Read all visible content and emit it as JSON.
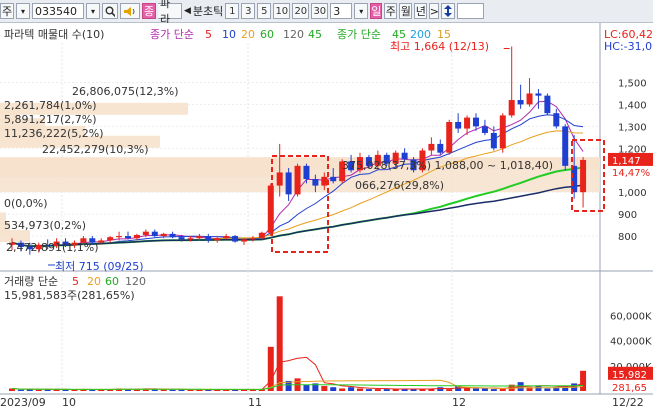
{
  "toolbar": {
    "market": "주",
    "code": "033540",
    "search_icon": "magnifier-icon",
    "sound_icon": "speaker-icon",
    "kind_badge": "종",
    "name_short": "파라",
    "prev_arrow": "◀",
    "interval_label": "분초틱",
    "intervals": [
      "1",
      "3",
      "5",
      "10",
      "20",
      "30"
    ],
    "interval_select": "3",
    "period_day": "일",
    "periods": [
      "주",
      "월",
      "년"
    ],
    "next_arrow": ">",
    "sort_icon": "updown-arrow-icon"
  },
  "price_pane": {
    "title": "파라텍 매물대 수(10)",
    "ma_title": "종가 단순",
    "ma_periods": [
      "5",
      "10",
      "20",
      "60",
      "120",
      "45"
    ],
    "ma2_title": "종가 단순",
    "ma2_periods": [
      "45",
      "200",
      "15"
    ],
    "lc_label": "LC:60,42",
    "hc_label": "HC:-31,0",
    "high_annotation": "최고 1,664 (12/13)",
    "low_annotation": "최저 715 (09/25)",
    "volume_profile": [
      "26,806,075(12,3%)",
      "2,261,784(1,0%)",
      "5,891,217(2,7%)",
      "11,236,222(5,2%)",
      "22,452,279(10,3%)",
      "0(0,0%)",
      "534,973(0,2%)",
      "2,472,891(1,1%)"
    ],
    "highlight_row_a": "375,028(37,3%) 1,088,00 ~ 1,018,40)",
    "highlight_row_b": "066,276(29,8%)",
    "y_ticks": [
      "1,500",
      "1,400",
      "1,300",
      "1,200",
      "1,000",
      "900",
      "800"
    ],
    "current_price": "1,147",
    "change_pct": "14,47%"
  },
  "volume_pane": {
    "title": "거래량 단순",
    "ma_periods": [
      "5",
      "20",
      "60",
      "120"
    ],
    "volume_text": "15,981,583주(281,65%)",
    "y_ticks": [
      "60,000K",
      "40,000K",
      "20,000K"
    ],
    "current_volume": "15,982",
    "volume_pct": "281,65"
  },
  "x_axis": [
    "2023/09",
    "10",
    "11",
    "12",
    "12/22"
  ],
  "colors": {
    "up": "#e8231b",
    "down": "#1f3fd0",
    "profile": "#f6e2cc",
    "ma_green": "#22cc22",
    "ma_orange": "#e8a020",
    "ma_purple": "#b02ab0",
    "ma_navy": "#1b2b66"
  },
  "chart_data": {
    "type": "candlestick",
    "title": "파라텍",
    "ylim": [
      700,
      1680
    ],
    "candles": [
      {
        "o": 760,
        "h": 790,
        "l": 735,
        "c": 770
      },
      {
        "o": 770,
        "h": 780,
        "l": 730,
        "c": 750
      },
      {
        "o": 750,
        "h": 770,
        "l": 715,
        "c": 740
      },
      {
        "o": 740,
        "h": 770,
        "l": 725,
        "c": 760
      },
      {
        "o": 760,
        "h": 785,
        "l": 740,
        "c": 755
      },
      {
        "o": 755,
        "h": 790,
        "l": 745,
        "c": 775
      },
      {
        "o": 775,
        "h": 790,
        "l": 750,
        "c": 760
      },
      {
        "o": 760,
        "h": 780,
        "l": 745,
        "c": 770
      },
      {
        "o": 770,
        "h": 800,
        "l": 760,
        "c": 790
      },
      {
        "o": 790,
        "h": 800,
        "l": 760,
        "c": 770
      },
      {
        "o": 770,
        "h": 790,
        "l": 760,
        "c": 780
      },
      {
        "o": 780,
        "h": 800,
        "l": 770,
        "c": 795
      },
      {
        "o": 795,
        "h": 820,
        "l": 780,
        "c": 800
      },
      {
        "o": 800,
        "h": 820,
        "l": 785,
        "c": 790
      },
      {
        "o": 790,
        "h": 810,
        "l": 780,
        "c": 805
      },
      {
        "o": 805,
        "h": 830,
        "l": 795,
        "c": 820
      },
      {
        "o": 820,
        "h": 830,
        "l": 795,
        "c": 800
      },
      {
        "o": 800,
        "h": 815,
        "l": 790,
        "c": 810
      },
      {
        "o": 810,
        "h": 820,
        "l": 790,
        "c": 795
      },
      {
        "o": 795,
        "h": 805,
        "l": 775,
        "c": 785
      },
      {
        "o": 785,
        "h": 800,
        "l": 775,
        "c": 790
      },
      {
        "o": 790,
        "h": 810,
        "l": 780,
        "c": 800
      },
      {
        "o": 800,
        "h": 810,
        "l": 770,
        "c": 780
      },
      {
        "o": 780,
        "h": 800,
        "l": 770,
        "c": 790
      },
      {
        "o": 790,
        "h": 810,
        "l": 785,
        "c": 800
      },
      {
        "o": 800,
        "h": 805,
        "l": 770,
        "c": 775
      },
      {
        "o": 775,
        "h": 790,
        "l": 760,
        "c": 785
      },
      {
        "o": 785,
        "h": 800,
        "l": 775,
        "c": 790
      },
      {
        "o": 790,
        "h": 820,
        "l": 785,
        "c": 815
      },
      {
        "o": 815,
        "h": 1040,
        "l": 800,
        "c": 1030
      },
      {
        "o": 1030,
        "h": 1220,
        "l": 980,
        "c": 1090
      },
      {
        "o": 1090,
        "h": 1110,
        "l": 960,
        "c": 990
      },
      {
        "o": 990,
        "h": 1130,
        "l": 980,
        "c": 1120
      },
      {
        "o": 1120,
        "h": 1130,
        "l": 1040,
        "c": 1060
      },
      {
        "o": 1060,
        "h": 1080,
        "l": 1000,
        "c": 1030
      },
      {
        "o": 1030,
        "h": 1090,
        "l": 1010,
        "c": 1070
      },
      {
        "o": 1070,
        "h": 1110,
        "l": 1040,
        "c": 1050
      },
      {
        "o": 1050,
        "h": 1150,
        "l": 1040,
        "c": 1140
      },
      {
        "o": 1140,
        "h": 1170,
        "l": 1090,
        "c": 1100
      },
      {
        "o": 1100,
        "h": 1180,
        "l": 1090,
        "c": 1160
      },
      {
        "o": 1160,
        "h": 1170,
        "l": 1110,
        "c": 1120
      },
      {
        "o": 1120,
        "h": 1190,
        "l": 1100,
        "c": 1170
      },
      {
        "o": 1170,
        "h": 1180,
        "l": 1120,
        "c": 1130
      },
      {
        "o": 1130,
        "h": 1190,
        "l": 1110,
        "c": 1180
      },
      {
        "o": 1180,
        "h": 1200,
        "l": 1140,
        "c": 1150
      },
      {
        "o": 1150,
        "h": 1160,
        "l": 1090,
        "c": 1100
      },
      {
        "o": 1100,
        "h": 1200,
        "l": 1090,
        "c": 1190
      },
      {
        "o": 1190,
        "h": 1250,
        "l": 1170,
        "c": 1220
      },
      {
        "o": 1220,
        "h": 1240,
        "l": 1170,
        "c": 1180
      },
      {
        "o": 1180,
        "h": 1330,
        "l": 1170,
        "c": 1320
      },
      {
        "o": 1320,
        "h": 1360,
        "l": 1270,
        "c": 1290
      },
      {
        "o": 1290,
        "h": 1350,
        "l": 1260,
        "c": 1340
      },
      {
        "o": 1340,
        "h": 1360,
        "l": 1280,
        "c": 1300
      },
      {
        "o": 1300,
        "h": 1330,
        "l": 1260,
        "c": 1270
      },
      {
        "o": 1270,
        "h": 1300,
        "l": 1190,
        "c": 1200
      },
      {
        "o": 1200,
        "h": 1360,
        "l": 1180,
        "c": 1350
      },
      {
        "o": 1350,
        "h": 1664,
        "l": 1340,
        "c": 1420
      },
      {
        "o": 1420,
        "h": 1490,
        "l": 1380,
        "c": 1400
      },
      {
        "o": 1400,
        "h": 1520,
        "l": 1390,
        "c": 1450
      },
      {
        "o": 1450,
        "h": 1470,
        "l": 1380,
        "c": 1440
      },
      {
        "o": 1440,
        "h": 1450,
        "l": 1350,
        "c": 1360
      },
      {
        "o": 1360,
        "h": 1380,
        "l": 1290,
        "c": 1300
      },
      {
        "o": 1300,
        "h": 1310,
        "l": 1100,
        "c": 1120
      },
      {
        "o": 1120,
        "h": 1260,
        "l": 970,
        "c": 1000
      },
      {
        "o": 1000,
        "h": 1160,
        "l": 930,
        "c": 1147
      }
    ],
    "volume": [
      2,
      1,
      1.5,
      1,
      1.2,
      1.5,
      1,
      1,
      1.5,
      1,
      1,
      1.5,
      2,
      1.5,
      1.2,
      2,
      1.5,
      1.2,
      1,
      1,
      1,
      1.2,
      1,
      1,
      1.5,
      1,
      1,
      1,
      1.5,
      35,
      75,
      8,
      10,
      5,
      6,
      4,
      3,
      2,
      3,
      2,
      1.5,
      1.5,
      1.5,
      1.5,
      2,
      1.5,
      1.5,
      2,
      3,
      1.5,
      4,
      2.5,
      2,
      2,
      1.5,
      2,
      5,
      7,
      3,
      4,
      2,
      3,
      4,
      6,
      16
    ]
  }
}
